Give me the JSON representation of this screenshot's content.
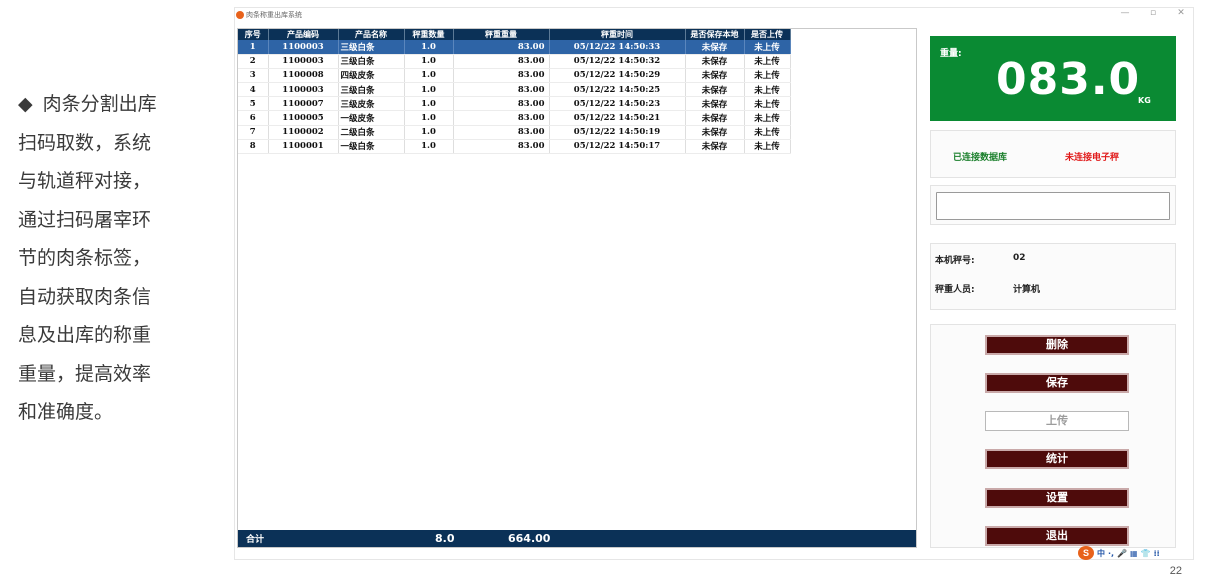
{
  "slide": {
    "bullet": "◆",
    "lines": [
      "肉条分割出库",
      "扫码取数，系统",
      "与轨道秤对接，",
      "通过扫码屠宰环",
      "节的肉条标签，",
      "自动获取肉条信",
      "息及出库的称重",
      "重量，提高效率",
      "和准确度。"
    ],
    "page_number": "22"
  },
  "window": {
    "title": "肉条称重出库系统",
    "controls": {
      "minimize": "—",
      "maximize": "▫",
      "close": "✕"
    }
  },
  "table": {
    "headers": [
      "序号",
      "产品编码",
      "产品名称",
      "秤重数量",
      "秤重重量",
      "秤重时间",
      "是否保存本地",
      "是否上传"
    ],
    "rows": [
      [
        "1",
        "1100003",
        "三级白条",
        "1.0",
        "83.00",
        "05/12/22 14:50:33",
        "未保存",
        "未上传"
      ],
      [
        "2",
        "1100003",
        "三级白条",
        "1.0",
        "83.00",
        "05/12/22 14:50:32",
        "未保存",
        "未上传"
      ],
      [
        "3",
        "1100008",
        "四级皮条",
        "1.0",
        "83.00",
        "05/12/22 14:50:29",
        "未保存",
        "未上传"
      ],
      [
        "4",
        "1100003",
        "三级白条",
        "1.0",
        "83.00",
        "05/12/22 14:50:25",
        "未保存",
        "未上传"
      ],
      [
        "5",
        "1100007",
        "三级皮条",
        "1.0",
        "83.00",
        "05/12/22 14:50:23",
        "未保存",
        "未上传"
      ],
      [
        "6",
        "1100005",
        "一级皮条",
        "1.0",
        "83.00",
        "05/12/22 14:50:21",
        "未保存",
        "未上传"
      ],
      [
        "7",
        "1100002",
        "二级白条",
        "1.0",
        "83.00",
        "05/12/22 14:50:19",
        "未保存",
        "未上传"
      ],
      [
        "8",
        "1100001",
        "一级白条",
        "1.0",
        "83.00",
        "05/12/22 14:50:17",
        "未保存",
        "未上传"
      ]
    ],
    "selected_row": 0,
    "total": {
      "label": "合计",
      "quantity": "8.0",
      "weight": "664.00"
    }
  },
  "weight_display": {
    "label": "重量:",
    "value": "083.0",
    "unit": "KG",
    "color": "#0a8a33"
  },
  "status": {
    "database": "已连接数据库",
    "scale": "未连接电子秤",
    "database_color": "#1a7f2b",
    "scale_color": "#e11b1b"
  },
  "scan": {
    "value": "",
    "placeholder": ""
  },
  "info": {
    "scale_no_label": "本机秤号:",
    "scale_no": "02",
    "operator_label": "秤重人员:",
    "operator": "计算机"
  },
  "buttons": {
    "delete": "删除",
    "save": "保存",
    "upload": "上传",
    "stats": "统计",
    "settings": "设置",
    "exit": "退出"
  },
  "tray": {
    "icon": "S",
    "items": [
      "中",
      "·,",
      "🎤",
      "▦",
      "👕",
      "⁞⁞"
    ]
  }
}
